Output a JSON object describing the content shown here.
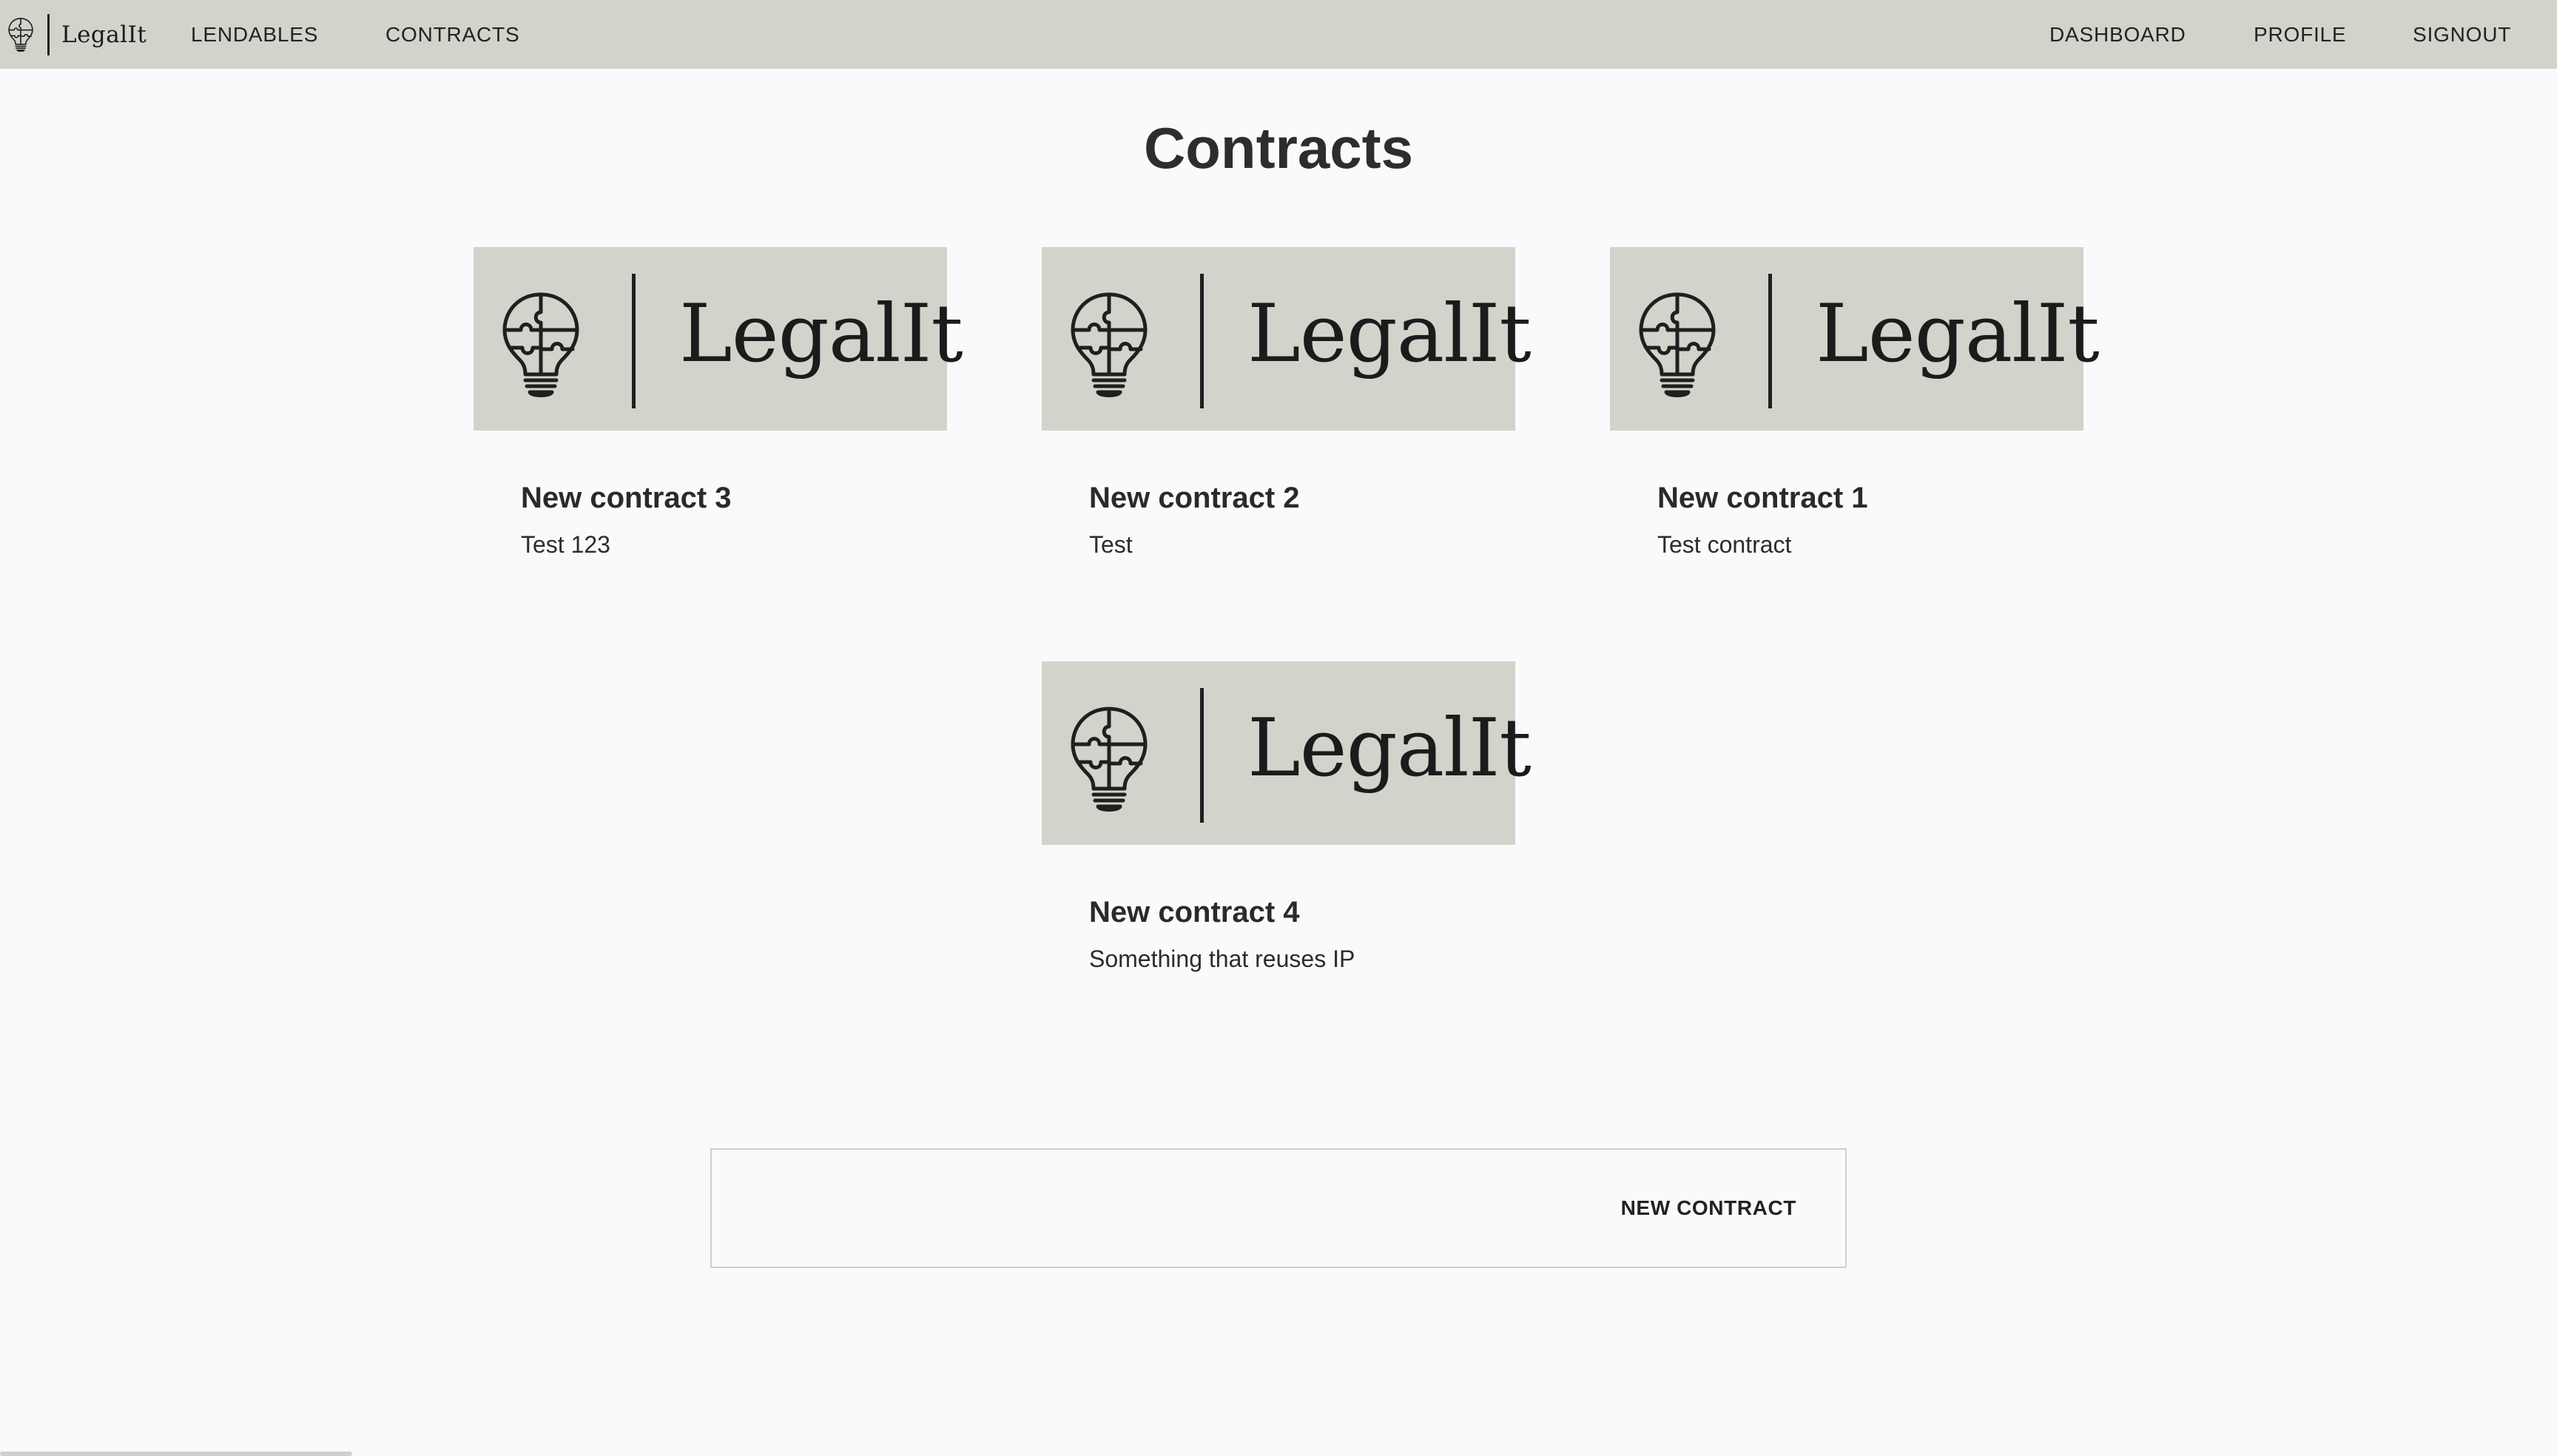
{
  "app": {
    "brand_name": "LegalIt"
  },
  "nav": {
    "left_links": [
      "LENDABLES",
      "CONTRACTS"
    ],
    "right_links": [
      "DASHBOARD",
      "PROFILE",
      "SIGNOUT"
    ]
  },
  "page": {
    "title": "Contracts"
  },
  "contracts": [
    {
      "banner_text": "LegalIt",
      "title": "New contract 3",
      "description": "Test 123"
    },
    {
      "banner_text": "LegalIt",
      "title": "New contract 2",
      "description": "Test"
    },
    {
      "banner_text": "LegalIt",
      "title": "New contract 1",
      "description": "Test contract"
    },
    {
      "banner_text": "LegalIt",
      "title": "New contract 4",
      "description": "Something that reuses IP"
    }
  ],
  "actions": {
    "new_contract_label": "NEW CONTRACT"
  },
  "colors": {
    "nav_background": "#d3d2cb",
    "page_background": "#f9fafb",
    "banner_background": "#d3d2cb",
    "text": "#2b2b2b"
  },
  "icons": {
    "logo": "lightbulb-puzzle-icon"
  }
}
